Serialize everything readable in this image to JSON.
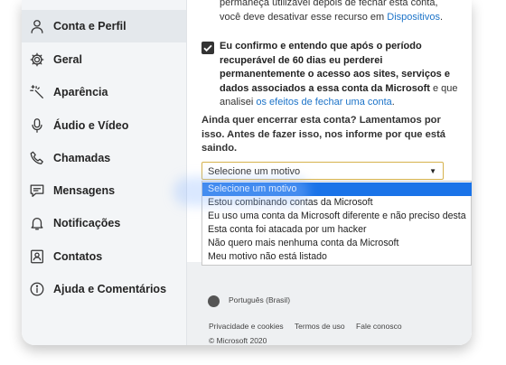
{
  "sidebar": {
    "items": [
      {
        "label": "Conta e Perfil",
        "icon": "person-icon",
        "active": true
      },
      {
        "label": "Geral",
        "icon": "gear-icon"
      },
      {
        "label": "Aparência",
        "icon": "magic-wand-icon"
      },
      {
        "label": "Áudio e Vídeo",
        "icon": "microphone-icon"
      },
      {
        "label": "Chamadas",
        "icon": "phone-icon"
      },
      {
        "label": "Mensagens",
        "icon": "message-icon"
      },
      {
        "label": "Notificações",
        "icon": "bell-icon"
      },
      {
        "label": "Contatos",
        "icon": "contacts-icon"
      },
      {
        "label": "Ajuda e Comentários",
        "icon": "info-icon"
      }
    ]
  },
  "content": {
    "top_line1": "permaneça utilizável depois de fechar esta conta,",
    "top_line2_pre": "você deve desativar esse recurso em ",
    "top_link": "Dispositivos",
    "top_line2_post": ".",
    "confirm_text": "Eu confirmo e entendo que após o período recuperável de 60 dias eu perderei permanentemente o acesso aos sites, serviços e dados associados a essa conta da Microsoft",
    "confirm_mid": " e que analisei ",
    "confirm_link": "os efeitos de fechar uma conta",
    "confirm_end": ".",
    "question": "Ainda quer encerrar esta conta? Lamentamos por isso. Antes de fazer isso, nos informe por que está saindo.",
    "select_value": "Selecione um motivo",
    "options": [
      "Selecione um motivo",
      "Estou combinando contas da Microsoft",
      "Eu uso uma conta da Microsoft diferente e não preciso desta",
      "Esta conta foi atacada por um hacker",
      "Não quero mais nenhuma conta da Microsoft",
      "Meu motivo não está listado"
    ]
  },
  "footer": {
    "language": "Português (Brasil)",
    "links": [
      "Privacidade e cookies",
      "Termos de uso",
      "Fale conosco"
    ],
    "copyright": "© Microsoft 2020"
  },
  "colors": {
    "accent": "#1c73c8",
    "selected_option": "#1a73e8",
    "select_border": "#d6b24d"
  }
}
